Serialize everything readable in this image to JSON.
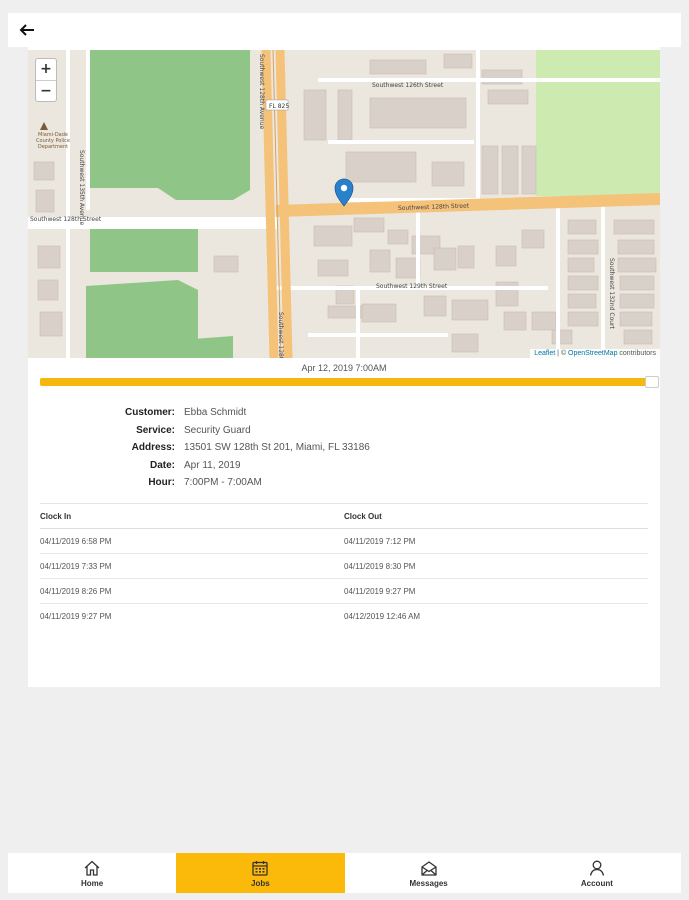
{
  "header": {
    "back_icon": "arrow-left-icon"
  },
  "map": {
    "zoom_in": "+",
    "zoom_out": "−",
    "attribution_leaflet": "Leaflet",
    "attribution_sep": " | © ",
    "attribution_osm": "OpenStreetMap",
    "attribution_suffix": " contributors",
    "marker_icon": "map-pin-icon",
    "labels": {
      "street_128th": "Southwest 128th Street",
      "street_128th_west": "Southwest 128th Street",
      "street_126th": "Southwest 126th Street",
      "street_129th": "Southwest 129th Street",
      "avenue_135th": "Southwest 135th Avenue",
      "avenue_128th": "Southwest 128th Avenue",
      "court_132nd": "Southwest 132nd Court",
      "fl_825": "FL 825",
      "police_dept": "Miami-Dade County Police Department"
    }
  },
  "timeline": {
    "label": "Apr 12, 2019 7:00AM",
    "progress": 0.99
  },
  "details": [
    {
      "label": "Customer:",
      "value": "Ebba Schmidt"
    },
    {
      "label": "Service:",
      "value": "Security Guard"
    },
    {
      "label": "Address:",
      "value": "13501 SW 128th St 201, Miami, FL 33186"
    },
    {
      "label": "Date:",
      "value": "Apr 11, 2019"
    },
    {
      "label": "Hour:",
      "value": "7:00PM - 7:00AM"
    }
  ],
  "clock_table": {
    "headers": [
      "Clock In",
      "Clock Out"
    ],
    "rows": [
      [
        "04/11/2019 6:58 PM",
        "04/11/2019 7:12 PM"
      ],
      [
        "04/11/2019 7:33 PM",
        "04/11/2019 8:30 PM"
      ],
      [
        "04/11/2019 8:26 PM",
        "04/11/2019 9:27 PM"
      ],
      [
        "04/11/2019 9:27 PM",
        "04/12/2019 12:46 AM"
      ]
    ]
  },
  "nav": [
    {
      "label": "Home",
      "icon": "home-icon",
      "active": false
    },
    {
      "label": "Jobs",
      "icon": "calendar-icon",
      "active": true
    },
    {
      "label": "Messages",
      "icon": "envelope-icon",
      "active": false
    },
    {
      "label": "Account",
      "icon": "user-icon",
      "active": false
    }
  ],
  "colors": {
    "accent": "#fbb90a",
    "park": "#8fc687",
    "road_major": "#f5c27a",
    "marker": "#2a81cb"
  }
}
